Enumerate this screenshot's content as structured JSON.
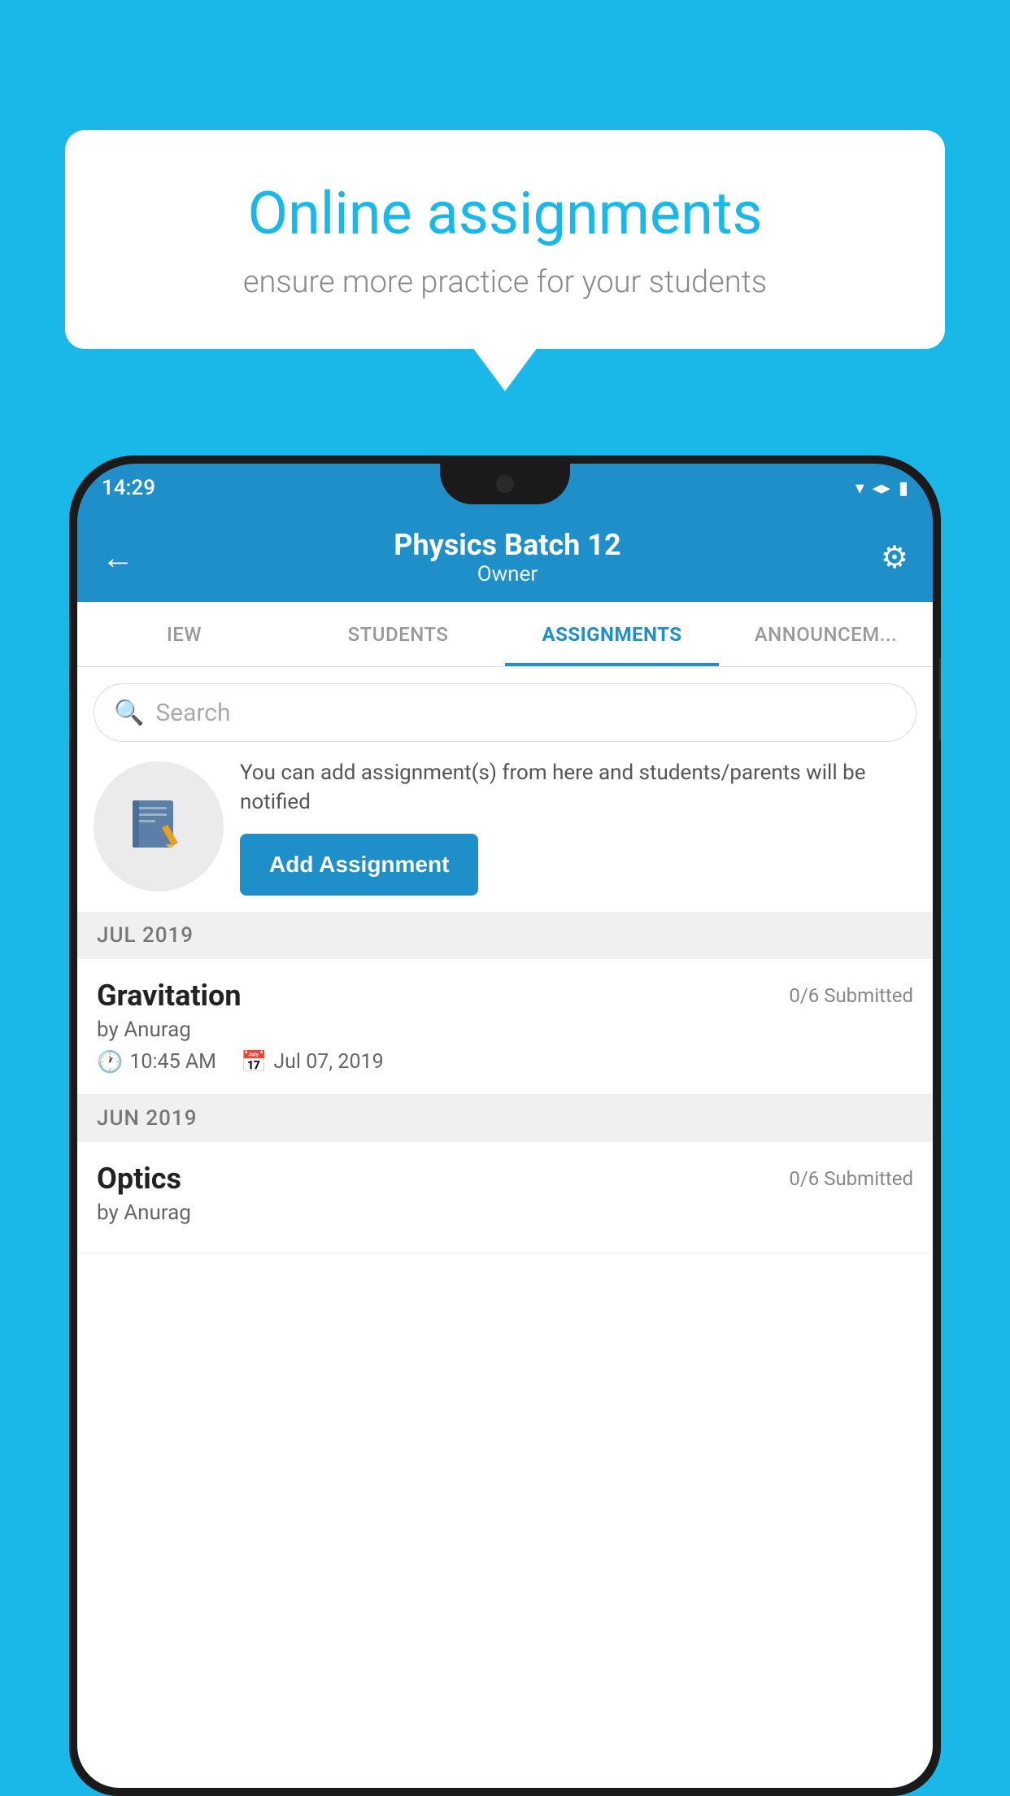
{
  "background": {
    "color": "#1ab8e8"
  },
  "speech_bubble": {
    "title": "Online assignments",
    "subtitle": "ensure more practice for your students"
  },
  "status_bar": {
    "time": "14:29",
    "wifi": "▼",
    "signal": "◀",
    "battery": "▮"
  },
  "header": {
    "title": "Physics Batch 12",
    "subtitle": "Owner",
    "back_label": "←",
    "settings_label": "⚙"
  },
  "tabs": [
    {
      "label": "IEW",
      "active": false
    },
    {
      "label": "STUDENTS",
      "active": false
    },
    {
      "label": "ASSIGNMENTS",
      "active": true
    },
    {
      "label": "ANNOUNCEM...",
      "active": false
    }
  ],
  "search": {
    "placeholder": "Search"
  },
  "promo": {
    "description": "You can add assignment(s) from here and students/parents will be notified",
    "button_label": "Add Assignment"
  },
  "sections": [
    {
      "label": "JUL 2019",
      "assignments": [
        {
          "name": "Gravitation",
          "submitted": "0/6 Submitted",
          "by": "by Anurag",
          "time": "10:45 AM",
          "date": "Jul 07, 2019"
        }
      ]
    },
    {
      "label": "JUN 2019",
      "assignments": [
        {
          "name": "Optics",
          "submitted": "0/6 Submitted",
          "by": "by Anurag",
          "time": "",
          "date": ""
        }
      ]
    }
  ]
}
